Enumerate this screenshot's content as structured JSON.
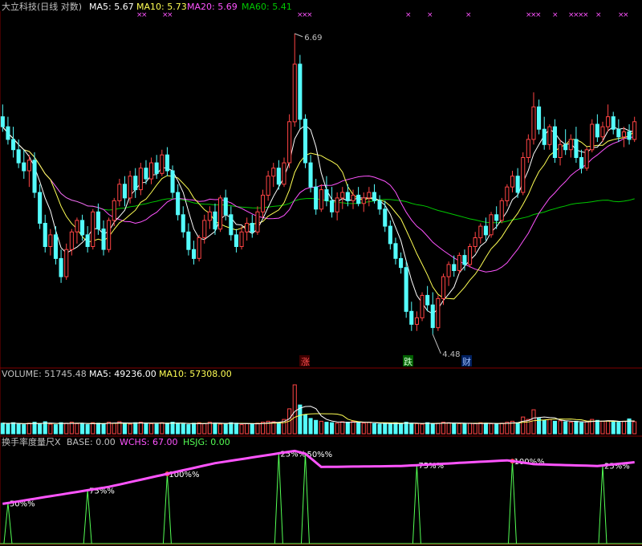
{
  "colors": {
    "up": "#ff4444",
    "down": "#54fcfc",
    "ma5": "#ffffff",
    "ma10": "#ffff54",
    "ma20": "#ff54ff",
    "ma60": "#00c800",
    "hsjg": "#54ff54",
    "signal": "#ff54ff",
    "text": "#c0c0c0",
    "panelLine": "#800000"
  },
  "header": {
    "title": "大立科技(日线 对数)",
    "ma5": "MA5: 5.67",
    "ma10": "MA10: 5.73",
    "ma20": "MA20: 5.69",
    "ma60": "MA60: 5.41"
  },
  "volume_header": {
    "volume": "VOLUME: 51745.48",
    "ma5": "MA5: 49236.00",
    "ma10": "MA10: 57308.00"
  },
  "indicator_header": {
    "name": "换手率度量尺X",
    "base": "BASE: 0.00",
    "wchs": "WCHS: 67.00",
    "hsjg": "HSJG: 0.00"
  },
  "price_annotations": {
    "high": "6.69",
    "low": "4.48",
    "marker_zhang": "涨",
    "marker_die": "跌",
    "marker_cai": "财"
  },
  "signal_marks": {
    "glyph": "×",
    "groups": [
      {
        "count": 2
      },
      {
        "count": 2
      },
      {
        "count": 3
      },
      {
        "count": 1
      },
      {
        "count": 1
      },
      {
        "count": 1
      },
      {
        "count": 3
      },
      {
        "count": 1
      },
      {
        "count": 4
      },
      {
        "count": 1
      },
      {
        "count": 2
      }
    ]
  },
  "chart_data": {
    "type": "candlestick",
    "price_range": [
      4.35,
      6.85
    ],
    "candles_ohlc": [
      [
        5.98,
        6.08,
        5.86,
        5.9
      ],
      [
        5.9,
        5.98,
        5.76,
        5.8
      ],
      [
        5.8,
        5.9,
        5.66,
        5.72
      ],
      [
        5.72,
        5.8,
        5.58,
        5.62
      ],
      [
        5.62,
        5.72,
        5.5,
        5.56
      ],
      [
        5.56,
        5.68,
        5.44,
        5.64
      ],
      [
        5.64,
        5.7,
        5.36,
        5.4
      ],
      [
        5.4,
        5.46,
        5.14,
        5.18
      ],
      [
        5.18,
        5.24,
        4.98,
        5.02
      ],
      [
        5.02,
        5.14,
        4.96,
        5.1
      ],
      [
        5.1,
        5.16,
        4.9,
        4.94
      ],
      [
        4.94,
        5.0,
        4.78,
        4.82
      ],
      [
        4.82,
        5.04,
        4.8,
        5.0
      ],
      [
        5.0,
        5.14,
        4.96,
        5.12
      ],
      [
        5.12,
        5.22,
        5.04,
        5.2
      ],
      [
        5.2,
        5.24,
        5.06,
        5.1
      ],
      [
        5.1,
        5.16,
        4.98,
        5.02
      ],
      [
        5.02,
        5.28,
        5.0,
        5.26
      ],
      [
        5.26,
        5.32,
        5.1,
        5.14
      ],
      [
        5.14,
        5.2,
        4.96,
        5.0
      ],
      [
        5.0,
        5.22,
        4.98,
        5.2
      ],
      [
        5.2,
        5.36,
        5.16,
        5.34
      ],
      [
        5.34,
        5.5,
        5.3,
        5.46
      ],
      [
        5.46,
        5.52,
        5.3,
        5.36
      ],
      [
        5.36,
        5.56,
        5.32,
        5.52
      ],
      [
        5.52,
        5.58,
        5.36,
        5.42
      ],
      [
        5.42,
        5.62,
        5.38,
        5.58
      ],
      [
        5.58,
        5.64,
        5.46,
        5.5
      ],
      [
        5.5,
        5.66,
        5.46,
        5.62
      ],
      [
        5.62,
        5.68,
        5.5,
        5.54
      ],
      [
        5.54,
        5.72,
        5.52,
        5.68
      ],
      [
        5.68,
        5.74,
        5.52,
        5.56
      ],
      [
        5.56,
        5.6,
        5.36,
        5.4
      ],
      [
        5.4,
        5.46,
        5.2,
        5.24
      ],
      [
        5.24,
        5.3,
        5.08,
        5.12
      ],
      [
        5.12,
        5.18,
        4.96,
        5.0
      ],
      [
        5.0,
        5.06,
        4.9,
        4.94
      ],
      [
        4.94,
        5.1,
        4.92,
        5.08
      ],
      [
        5.08,
        5.24,
        5.04,
        5.2
      ],
      [
        5.2,
        5.3,
        5.14,
        5.26
      ],
      [
        5.26,
        5.32,
        5.1,
        5.14
      ],
      [
        5.14,
        5.38,
        5.12,
        5.36
      ],
      [
        5.36,
        5.42,
        5.2,
        5.24
      ],
      [
        5.24,
        5.3,
        5.06,
        5.1
      ],
      [
        5.1,
        5.14,
        4.98,
        5.02
      ],
      [
        5.02,
        5.16,
        5.0,
        5.12
      ],
      [
        5.12,
        5.22,
        5.06,
        5.18
      ],
      [
        5.18,
        5.24,
        5.08,
        5.12
      ],
      [
        5.12,
        5.3,
        5.1,
        5.26
      ],
      [
        5.26,
        5.42,
        5.22,
        5.38
      ],
      [
        5.38,
        5.56,
        5.34,
        5.52
      ],
      [
        5.52,
        5.62,
        5.44,
        5.58
      ],
      [
        5.58,
        5.64,
        5.42,
        5.46
      ],
      [
        5.46,
        5.66,
        5.44,
        5.62
      ],
      [
        5.62,
        6.0,
        5.58,
        5.94
      ],
      [
        5.94,
        6.69,
        5.9,
        6.42
      ],
      [
        6.42,
        6.5,
        5.88,
        5.96
      ],
      [
        5.96,
        6.0,
        5.58,
        5.62
      ],
      [
        5.62,
        5.68,
        5.4,
        5.44
      ],
      [
        5.44,
        5.5,
        5.24,
        5.28
      ],
      [
        5.28,
        5.46,
        5.26,
        5.42
      ],
      [
        5.42,
        5.52,
        5.3,
        5.34
      ],
      [
        5.34,
        5.44,
        5.22,
        5.26
      ],
      [
        5.26,
        5.4,
        5.2,
        5.36
      ],
      [
        5.36,
        5.44,
        5.28,
        5.4
      ],
      [
        5.4,
        5.46,
        5.3,
        5.34
      ],
      [
        5.34,
        5.42,
        5.28,
        5.38
      ],
      [
        5.38,
        5.44,
        5.3,
        5.32
      ],
      [
        5.32,
        5.4,
        5.26,
        5.36
      ],
      [
        5.36,
        5.44,
        5.3,
        5.4
      ],
      [
        5.4,
        5.46,
        5.32,
        5.34
      ],
      [
        5.34,
        5.38,
        5.24,
        5.28
      ],
      [
        5.28,
        5.34,
        5.12,
        5.16
      ],
      [
        5.16,
        5.2,
        5.0,
        5.04
      ],
      [
        5.04,
        5.08,
        4.9,
        4.94
      ],
      [
        4.94,
        4.98,
        4.84,
        4.88
      ],
      [
        4.88,
        4.92,
        4.56,
        4.6
      ],
      [
        4.6,
        4.66,
        4.48,
        4.52
      ],
      [
        4.52,
        4.6,
        4.48,
        4.56
      ],
      [
        4.56,
        4.72,
        4.54,
        4.7
      ],
      [
        4.7,
        4.76,
        4.6,
        4.64
      ],
      [
        4.64,
        4.72,
        4.46,
        4.5
      ],
      [
        4.5,
        4.7,
        4.48,
        4.68
      ],
      [
        4.68,
        4.84,
        4.64,
        4.82
      ],
      [
        4.82,
        4.92,
        4.76,
        4.9
      ],
      [
        4.9,
        4.96,
        4.82,
        4.86
      ],
      [
        4.86,
        4.98,
        4.84,
        4.96
      ],
      [
        4.96,
        5.0,
        4.86,
        4.9
      ],
      [
        4.9,
        5.04,
        4.88,
        5.02
      ],
      [
        5.02,
        5.12,
        4.98,
        5.08
      ],
      [
        5.08,
        5.18,
        5.04,
        5.16
      ],
      [
        5.16,
        5.22,
        5.06,
        5.1
      ],
      [
        5.1,
        5.26,
        5.08,
        5.24
      ],
      [
        5.24,
        5.3,
        5.14,
        5.2
      ],
      [
        5.2,
        5.36,
        5.18,
        5.34
      ],
      [
        5.34,
        5.46,
        5.3,
        5.44
      ],
      [
        5.44,
        5.56,
        5.4,
        5.52
      ],
      [
        5.52,
        5.58,
        5.36,
        5.4
      ],
      [
        5.4,
        5.7,
        5.38,
        5.66
      ],
      [
        5.66,
        5.84,
        5.62,
        5.8
      ],
      [
        5.8,
        6.18,
        5.76,
        6.06
      ],
      [
        6.06,
        6.12,
        5.84,
        5.88
      ],
      [
        5.88,
        5.98,
        5.72,
        5.76
      ],
      [
        5.76,
        5.92,
        5.72,
        5.9
      ],
      [
        5.9,
        5.96,
        5.62,
        5.66
      ],
      [
        5.66,
        5.8,
        5.6,
        5.76
      ],
      [
        5.76,
        5.88,
        5.68,
        5.72
      ],
      [
        5.72,
        5.84,
        5.66,
        5.8
      ],
      [
        5.8,
        5.9,
        5.62,
        5.66
      ],
      [
        5.66,
        5.72,
        5.54,
        5.58
      ],
      [
        5.58,
        5.74,
        5.56,
        5.72
      ],
      [
        5.72,
        5.96,
        5.7,
        5.92
      ],
      [
        5.92,
        6.0,
        5.78,
        5.82
      ],
      [
        5.82,
        5.94,
        5.78,
        5.9
      ],
      [
        5.9,
        6.08,
        5.86,
        5.98
      ],
      [
        5.98,
        6.02,
        5.84,
        5.88
      ],
      [
        5.88,
        5.96,
        5.78,
        5.82
      ],
      [
        5.82,
        5.9,
        5.74,
        5.86
      ],
      [
        5.86,
        5.92,
        5.76,
        5.8
      ],
      [
        5.8,
        5.98,
        5.78,
        5.94
      ]
    ],
    "volume_range": [
      0,
      112000
    ],
    "volume": [
      22000,
      21000,
      23000,
      20000,
      19000,
      22000,
      24000,
      21000,
      25000,
      20000,
      19000,
      23000,
      22000,
      24000,
      21000,
      20000,
      19000,
      23000,
      22000,
      21000,
      24000,
      22000,
      25000,
      21000,
      20000,
      23000,
      24000,
      22000,
      21000,
      20000,
      23000,
      22000,
      24000,
      21000,
      20000,
      19000,
      22000,
      23000,
      21000,
      24000,
      22000,
      20000,
      21000,
      23000,
      22000,
      19000,
      21000,
      20000,
      22000,
      24000,
      26000,
      25000,
      23000,
      30000,
      52000,
      102000,
      60000,
      40000,
      32000,
      28000,
      26000,
      24000,
      23000,
      22000,
      25000,
      24000,
      26000,
      23000,
      22000,
      24000,
      21000,
      20000,
      22000,
      21000,
      23000,
      20000,
      24000,
      22000,
      21000,
      20000,
      23000,
      21000,
      22000,
      24000,
      23000,
      22000,
      21000,
      20000,
      22000,
      21000,
      23000,
      22000,
      21000,
      20000,
      22000,
      24000,
      26000,
      23000,
      35000,
      30000,
      50000,
      32000,
      28000,
      30000,
      26000,
      27000,
      25000,
      24000,
      26000,
      23000,
      25000,
      30000,
      28000,
      26000,
      27000,
      25000,
      24000,
      26000,
      31000,
      25000
    ],
    "indicator_range": [
      0,
      100
    ],
    "turnover_peaks": [
      {
        "index": 1,
        "level": 50,
        "label": "50%%"
      },
      {
        "index": 16,
        "level": 75,
        "label": "75%%"
      },
      {
        "index": 31,
        "level": 100,
        "label": "100%%"
      },
      {
        "index": 52,
        "level": 25,
        "label": "25%%"
      },
      {
        "index": 57,
        "level": 50,
        "label": "50%%"
      },
      {
        "index": 78,
        "level": 75,
        "label": "75%%"
      },
      {
        "index": 96,
        "level": 100,
        "label": "100%%"
      },
      {
        "index": 113,
        "level": 25,
        "label": "25%%"
      }
    ]
  }
}
